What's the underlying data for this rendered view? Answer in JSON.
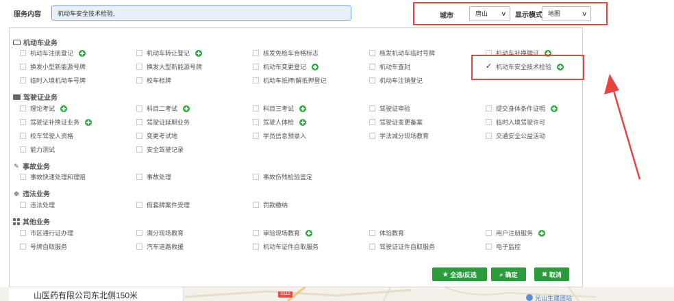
{
  "search": {
    "label": "服务内容",
    "value": "机动车安全技术检验,"
  },
  "filters": {
    "city_label": "城市",
    "city_value": "唐山",
    "mode_label": "显示模式",
    "mode_value": "地图"
  },
  "categories": [
    {
      "name": "机动车业务",
      "icon": "car-icon",
      "items": [
        {
          "label": "机动车注册登记",
          "plus": true,
          "checked": false
        },
        {
          "label": "机动车转让登记",
          "plus": true,
          "checked": false
        },
        {
          "label": "核发免检车合格标志",
          "plus": false,
          "checked": false
        },
        {
          "label": "核发机动车临时号牌",
          "plus": false,
          "checked": false
        },
        {
          "label": "机动车补换牌证",
          "plus": true,
          "checked": false
        },
        {
          "label": "换发小型新能源号牌",
          "plus": false,
          "checked": false
        },
        {
          "label": "换发大型新能源号牌",
          "plus": false,
          "checked": false
        },
        {
          "label": "机动车变更登记",
          "plus": true,
          "checked": false
        },
        {
          "label": "机动车查封",
          "plus": false,
          "checked": false
        },
        {
          "label": "机动车安全技术检验",
          "plus": true,
          "checked": true
        },
        {
          "label": "临时入境机动车号牌",
          "plus": false,
          "checked": false
        },
        {
          "label": "校车标牌",
          "plus": false,
          "checked": false
        },
        {
          "label": "机动车抵押/解抵押登记",
          "plus": false,
          "checked": false
        },
        {
          "label": "机动车注销登记",
          "plus": false,
          "checked": false
        }
      ]
    },
    {
      "name": "驾驶证业务",
      "icon": "id-card-icon",
      "items": [
        {
          "label": "理论考试",
          "plus": true,
          "checked": false
        },
        {
          "label": "科目二考试",
          "plus": true,
          "checked": false
        },
        {
          "label": "科目三考试",
          "plus": true,
          "checked": false
        },
        {
          "label": "驾驶证审验",
          "plus": false,
          "checked": false
        },
        {
          "label": "提交身体条件证明",
          "plus": true,
          "checked": false
        },
        {
          "label": "驾驶证补换证业务",
          "plus": true,
          "checked": false
        },
        {
          "label": "驾驶证延期业务",
          "plus": false,
          "checked": false
        },
        {
          "label": "驾驶人体检",
          "plus": true,
          "checked": false
        },
        {
          "label": "驾驶证变更备案",
          "plus": false,
          "checked": false
        },
        {
          "label": "临时入境驾驶许可",
          "plus": false,
          "checked": false
        },
        {
          "label": "校车驾驶人资格",
          "plus": false,
          "checked": false
        },
        {
          "label": "变更考试地",
          "plus": false,
          "checked": false
        },
        {
          "label": "学员信息预录入",
          "plus": false,
          "checked": false
        },
        {
          "label": "学法减分现场教育",
          "plus": false,
          "checked": false
        },
        {
          "label": "交通安全公益活动",
          "plus": false,
          "checked": false
        },
        {
          "label": "能力测试",
          "plus": false,
          "checked": false
        },
        {
          "label": "安全驾驶记录",
          "plus": false,
          "checked": false
        }
      ]
    },
    {
      "name": "事故业务",
      "icon": "accident-icon",
      "items": [
        {
          "label": "事故快速处理和理赔",
          "plus": false,
          "checked": false
        },
        {
          "label": "事故处理",
          "plus": false,
          "checked": false
        },
        {
          "label": "事故伤残检验鉴定",
          "plus": false,
          "checked": false
        }
      ]
    },
    {
      "name": "违法业务",
      "icon": "violation-icon",
      "items": [
        {
          "label": "违法处理",
          "plus": false,
          "checked": false
        },
        {
          "label": "假套牌案件受理",
          "plus": false,
          "checked": false
        },
        {
          "label": "罚款缴纳",
          "plus": false,
          "checked": false
        }
      ]
    },
    {
      "name": "其他业务",
      "icon": "grid-icon",
      "items": [
        {
          "label": "市区通行证办理",
          "plus": false,
          "checked": false
        },
        {
          "label": "满分现场教育",
          "plus": false,
          "checked": false
        },
        {
          "label": "审验现场教育",
          "plus": true,
          "checked": false
        },
        {
          "label": "体验教育",
          "plus": false,
          "checked": false
        },
        {
          "label": "用户注册服务",
          "plus": true,
          "checked": false
        },
        {
          "label": "号牌自取服务",
          "plus": false,
          "checked": false
        },
        {
          "label": "汽车道路救援",
          "plus": false,
          "checked": false
        },
        {
          "label": "机动车证件自取服务",
          "plus": false,
          "checked": false
        },
        {
          "label": "驾驶证证件自取服务",
          "plus": false,
          "checked": false
        },
        {
          "label": "电子监控",
          "plus": false,
          "checked": false
        }
      ]
    }
  ],
  "buttons": {
    "select_all": "全选/反选",
    "confirm": "确定",
    "cancel": "取消"
  },
  "map": {
    "address": "山医药有限公司东北侧150米",
    "road_badge": "G112",
    "poi_text": "光山生建团站"
  },
  "colors": {
    "accent_green": "#2c9b3c",
    "plus_green": "#2bab3e",
    "annotation_red": "#e64343",
    "input_border": "#6a9fe0"
  }
}
